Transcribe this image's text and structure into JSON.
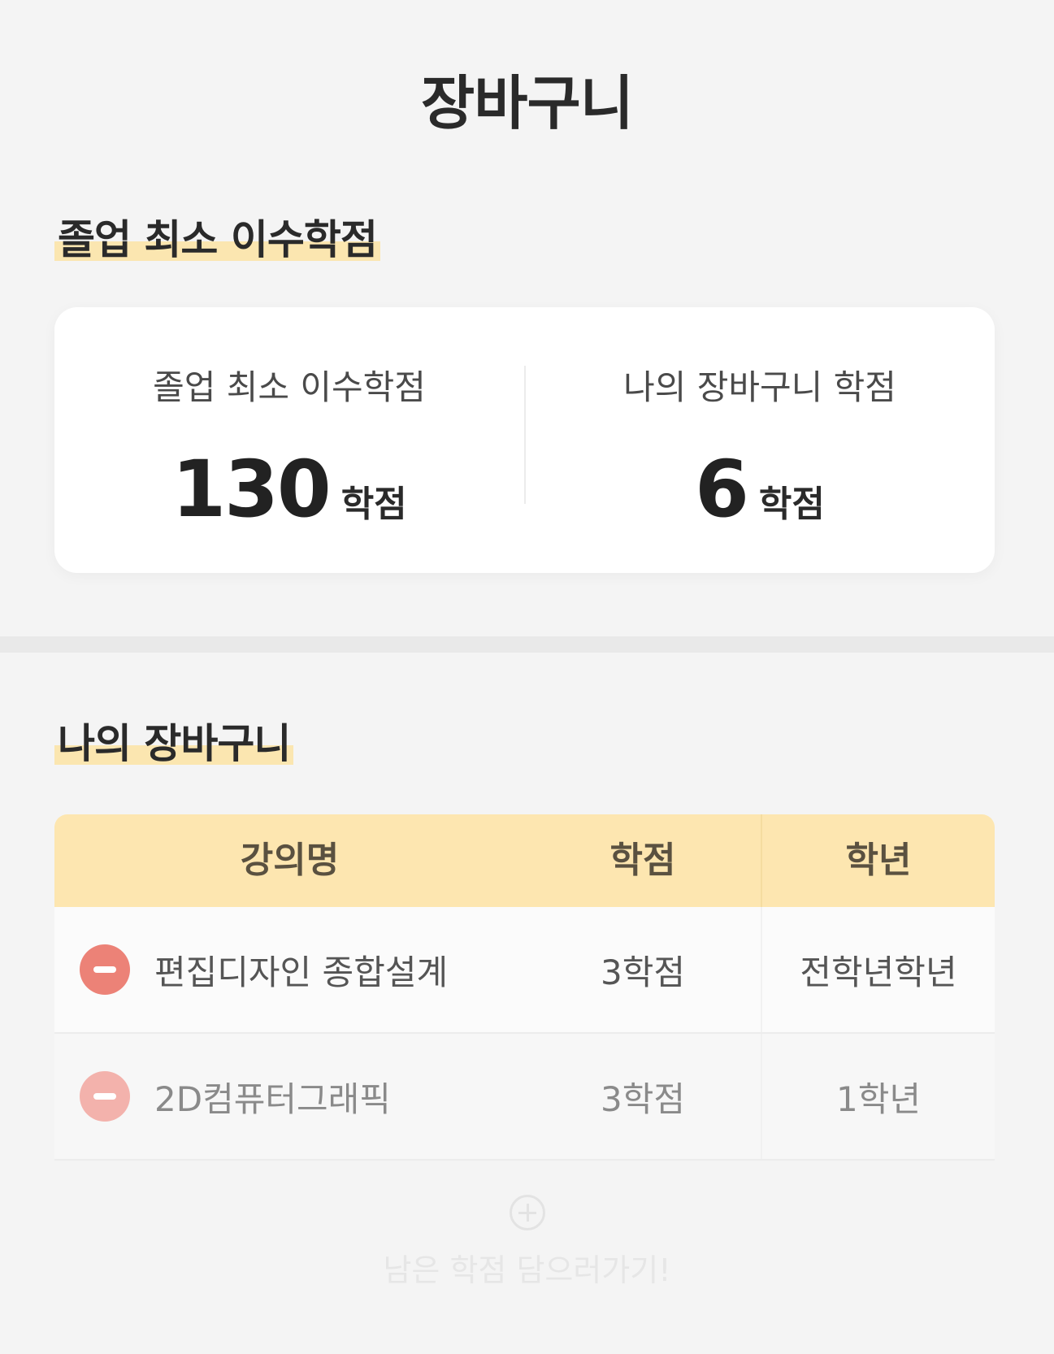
{
  "header": {
    "title": "장바구니"
  },
  "graduation_section": {
    "heading": "졸업 최소 이수학점",
    "card": {
      "left": {
        "label": "졸업 최소 이수학점",
        "value": "130",
        "unit": "학점"
      },
      "right": {
        "label": "나의 장바구니 학점",
        "value": "6",
        "unit": "학점"
      }
    }
  },
  "cart_section": {
    "heading": "나의 장바구니",
    "columns": [
      "강의명",
      "학점",
      "학년"
    ],
    "rows": [
      {
        "name": "편집디자인 종합설계",
        "credit": "3학점",
        "grade": "전학년학년"
      },
      {
        "name": "2D컴퓨터그래픽",
        "credit": "3학점",
        "grade": "1학년"
      }
    ],
    "add_label": "남은 학점 담으러가기!"
  },
  "colors": {
    "highlight": "#fbe6b0",
    "table_header": "#fde6b0",
    "remove_button": "#ec8277"
  },
  "icons": {
    "remove": "minus-circle-icon",
    "add": "plus-circle-icon"
  }
}
